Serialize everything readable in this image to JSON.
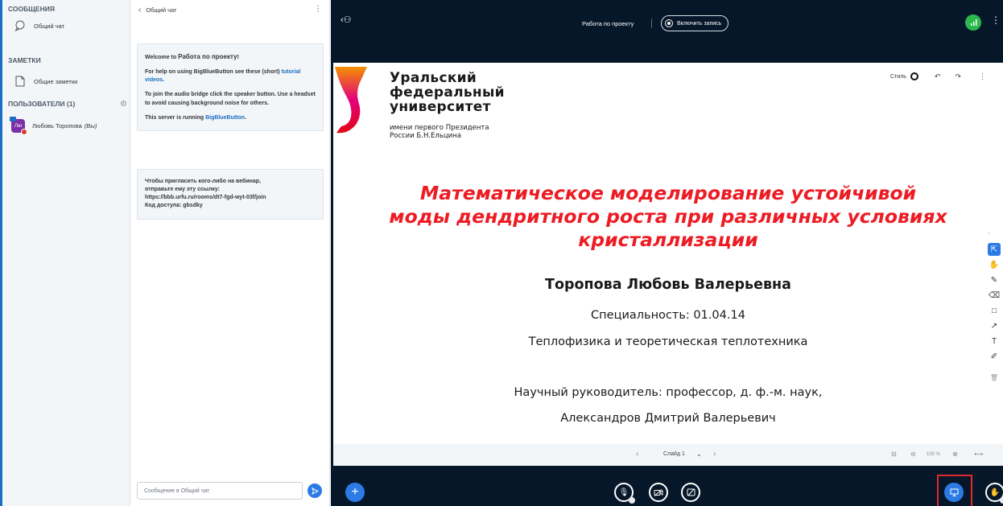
{
  "sidebar": {
    "messages_heading": "СООБЩЕНИЯ",
    "public_chat": "Общий чат",
    "notes_heading": "ЗАМЕТКИ",
    "shared_notes": "Общие заметки",
    "users_heading": "ПОЛЬЗОВАТЕЛИ (1)",
    "user": {
      "initials": "Лю",
      "name": "Любовь Торопова",
      "you": "(Вы)"
    }
  },
  "chat": {
    "title": "Общий чат",
    "welcome": {
      "line1_prefix": "Welcome to ",
      "line1_bold": "Работа по проекту",
      "line1_suffix": "!",
      "help_prefix": "For help on using BigBlueButton see these (short) ",
      "help_link": "tutorial videos",
      "help_suffix": ".",
      "audio": "To join the audio bridge click the speaker button. Use a headset to avoid causing background noise for others.",
      "server_prefix": "This server is running ",
      "server_link": "BigBlueButton",
      "server_suffix": "."
    },
    "invite": {
      "line1": "Чтобы пригласить кого-либо на вебинар,",
      "line2": "отправьте ему эту ссылку:",
      "link": "https://bbb.urfu.ru/rooms/dt7-fgd-wyt-03f/join",
      "code": "Код доступа: gbsdky"
    },
    "input_placeholder": "Сообщение в Общий чат"
  },
  "topbar": {
    "meeting_title": "Работа по проекту",
    "record_label": "Включить запись"
  },
  "slide": {
    "uni_line1": "Уральский",
    "uni_line2": "федеральный",
    "uni_line3": "университет",
    "uni_sub1": "имени первого Президента",
    "uni_sub2": "России Б.Н.Ельцина",
    "title_line1": "Математическое моделирование устойчивой",
    "title_line2": "моды дендритного роста при различных условиях",
    "title_line3": "кристаллизации",
    "author": "Торопова Любовь Валерьевна",
    "specialty": "Специальность: 01.04.14",
    "specialty_name": "Теплофизика и теоретическая теплотехника",
    "supervisor1": "Научный руководитель: профессор, д. ф.-м. наук,",
    "supervisor2": "Александров Дмитрий Валерьевич"
  },
  "toolbar": {
    "style_label": "Стиль"
  },
  "slidenav": {
    "current": "Слайд 1",
    "zoom": "100 %"
  },
  "colors": {
    "accent": "#2c7be5",
    "main_bg": "#06172a",
    "title_red": "#ed1c24"
  }
}
